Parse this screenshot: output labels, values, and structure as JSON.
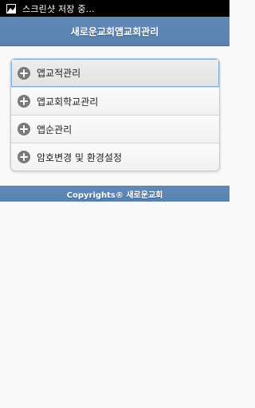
{
  "statusbar": {
    "notification_icon": "image-icon",
    "notification_text": "스크린샷 저장 중..."
  },
  "header": {
    "title": "새로운교회앱교회관리"
  },
  "menu": {
    "items": [
      {
        "label": "앱교적관리",
        "icon": "plus-circle-icon",
        "active": true
      },
      {
        "label": "앱교회학교관리",
        "icon": "plus-circle-icon",
        "active": false
      },
      {
        "label": "앱순관리",
        "icon": "plus-circle-icon",
        "active": false
      },
      {
        "label": "암호변경 및 환경설정",
        "icon": "plus-circle-icon",
        "active": false
      }
    ]
  },
  "footer": {
    "copyright": "Copyrights® 새로운교회"
  },
  "colors": {
    "header_bg": "#5a82b0",
    "statusbar_bg": "#000000",
    "active_outline": "#7fb0e0"
  }
}
